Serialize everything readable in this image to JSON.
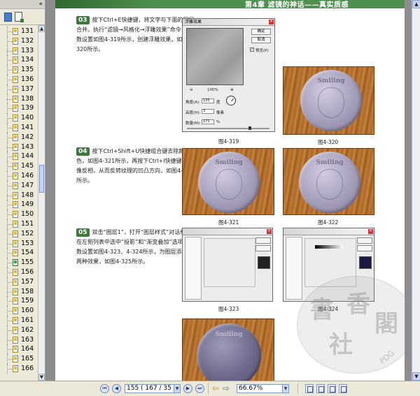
{
  "sidebar": {
    "bookmarks": [
      "131",
      "132",
      "133",
      "134",
      "135",
      "136",
      "137",
      "138",
      "139",
      "140",
      "141",
      "142",
      "143",
      "144",
      "145",
      "146",
      "147",
      "148",
      "149",
      "150",
      "151",
      "152",
      "153",
      "154",
      "155",
      "156",
      "157",
      "158",
      "159",
      "160",
      "161",
      "162",
      "163",
      "164",
      "165",
      "166"
    ],
    "current": "155",
    "collapse_glyph": "«"
  },
  "page": {
    "header_title": "第4章 滤镜的神话——真实质感",
    "step03": {
      "num": "03",
      "text": "按下Ctrl+E快捷键，将文字与下面的图层合并。执行“滤镜→风格化→浮雕效果”命令，参数设置如图4-319所示，创建浮雕效果，如图4-320所示。"
    },
    "step04": {
      "num": "04",
      "text": "按下Ctrl+Shift+U快捷组合键去除颜色，如图4-321所示，再按下Ctrl+I快捷键将图像反相，从而反转纹理的凹凸方向，如图4-322所示。"
    },
    "step05": {
      "num": "05",
      "text": "双击“图层1”，打开“图层样式”对话框，在左侧列表中选中“投影”和“渐变叠加”选项，参数设置如图4-323、4-324所示，为图层添加这两种效果，如图4-325所示。"
    },
    "emboss_dialog": {
      "title": "浮雕效果",
      "ok": "确定",
      "cancel": "取消",
      "preview": "预览(P)",
      "zoom": "100%",
      "angle_label": "角度(A):",
      "angle_value": "135",
      "angle_unit": "度",
      "height_label": "高度(H):",
      "height_value": "3",
      "height_unit": "像素",
      "amount_label": "数量(M):",
      "amount_value": "171",
      "amount_unit": "%"
    },
    "coin_text": "Smiling",
    "captions": {
      "f319": "图4-319",
      "f320": "图4-320",
      "f321": "图4-321",
      "f322": "图4-322",
      "f323": "图4-323",
      "f324": "图4-324"
    },
    "watermark": {
      "pdg": "PDG"
    }
  },
  "toolbar": {
    "first_glyph": "⏮",
    "prev_glyph": "◀",
    "page_value": "155  ( 167 / 35",
    "next_glyph": "▶",
    "last_glyph": "⏭",
    "back_glyph": "⇦",
    "forward_glyph": "⇨",
    "zoom_value": "66.67%",
    "dropdown_glyph": "▼"
  }
}
